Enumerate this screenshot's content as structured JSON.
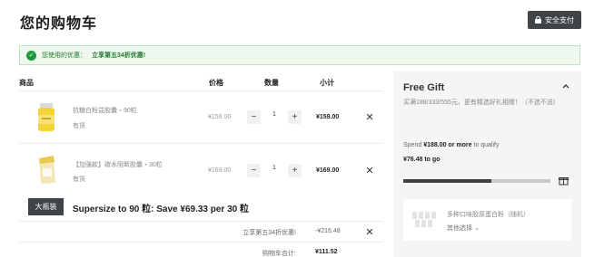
{
  "header": {
    "title": "您的购物车",
    "secure_checkout": "安全支付"
  },
  "coupon": {
    "prefix": "您使用的优惠：",
    "name": "立享第五34折优惠!"
  },
  "table": {
    "headers": [
      "商品",
      "价格",
      "数量",
      "小计"
    ]
  },
  "items": [
    {
      "name": "抗糖白粉益胶囊・90粒",
      "stock": "有货",
      "price": "¥159.00",
      "qty": "1",
      "subtotal": "¥159.00"
    },
    {
      "name": "【加强款】碳水阻断胶囊・30粒",
      "stock": "有货",
      "price": "¥169.00",
      "qty": "1",
      "subtotal": "¥169.00"
    }
  ],
  "upsell": {
    "badge": "大瓶装",
    "text": "Supersize to 90 粒: Save ¥69.33 per 30 粒"
  },
  "summary": {
    "discount_label": "立享第五34折优惠!",
    "discount_value": "-¥216.48",
    "cart_total_label": "购物车合计:",
    "cart_total_value": "¥111.52"
  },
  "free_gift": {
    "title": "Free Gift",
    "description": "买满188/333/555元，更有精选好礼相赠！（不选不送）",
    "spend_prefix": "Spend ",
    "spend_amount": "¥188.00 or more",
    "spend_suffix": " to qualify",
    "to_go": "¥76.48 to go",
    "progress": 0.6,
    "gift_name": "多种口味胶原蛋白粉（随机）",
    "gift_select": "其他选择 ⌄"
  },
  "colors": {
    "accent_dark": "#3e4347",
    "success_green": "#1f9a3a",
    "sidebar_bg": "#f5f5f5"
  }
}
